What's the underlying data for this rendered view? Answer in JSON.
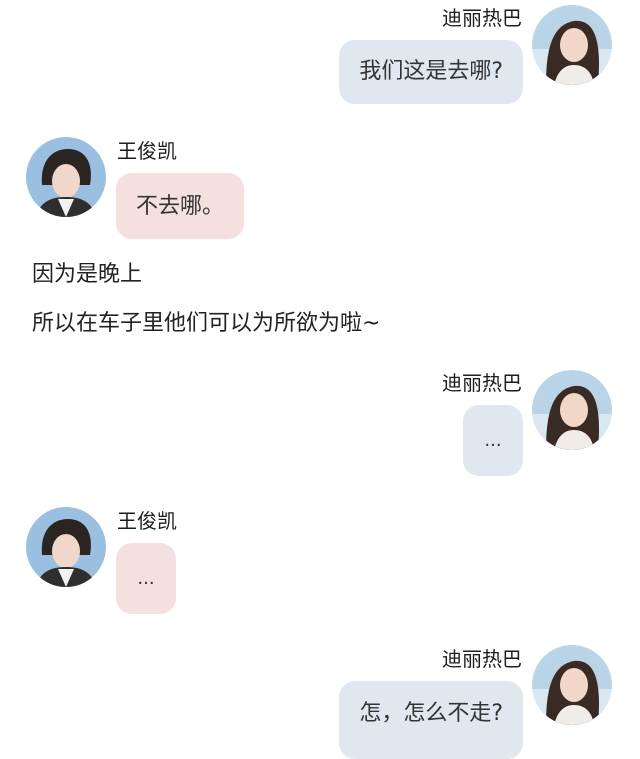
{
  "chat": {
    "messages": [
      {
        "speaker": "迪丽热巴",
        "avatar_icon": "female-portrait-icon",
        "text": "我们这是去哪?"
      },
      {
        "speaker": "王俊凯",
        "avatar_icon": "male-portrait-icon",
        "text": "不去哪。"
      },
      {
        "speaker": "迪丽热巴",
        "avatar_icon": "female-portrait-icon",
        "text": "..."
      },
      {
        "speaker": "王俊凯",
        "avatar_icon": "male-portrait-icon",
        "text": "..."
      },
      {
        "speaker": "迪丽热巴",
        "avatar_icon": "female-portrait-icon",
        "text": "怎，怎么不走?"
      }
    ],
    "narration": [
      "因为是晚上",
      "所以在车子里他们可以为所欲为啦~"
    ]
  },
  "colors": {
    "right_bubble": "#e0e7ef",
    "left_bubble": "#f3e0df",
    "text": "#333333"
  }
}
